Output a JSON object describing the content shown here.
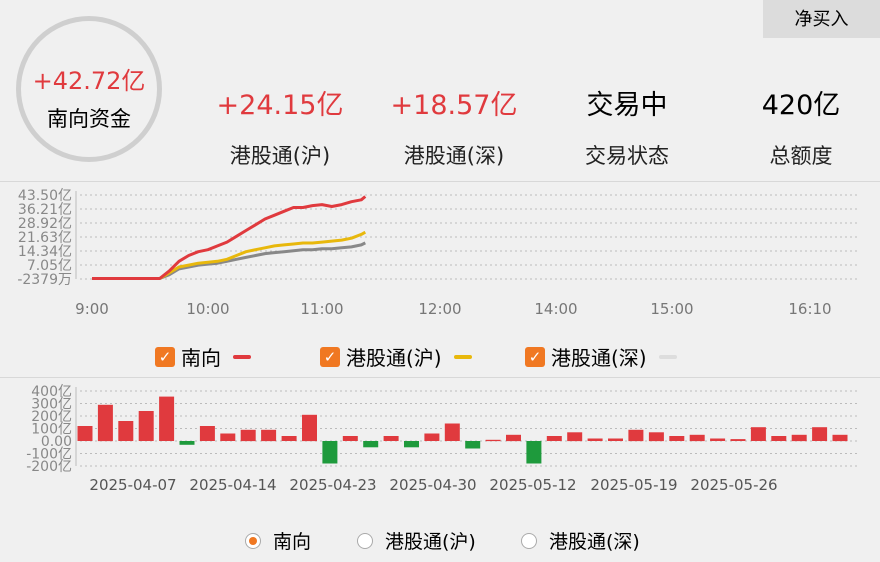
{
  "summary": {
    "total_value": "+42.72亿",
    "total_label": "南向资金",
    "buy_button": "净买入",
    "stats": [
      {
        "value": "+24.15亿",
        "label": "港股通(沪)"
      },
      {
        "value": "+18.57亿",
        "label": "港股通(深)"
      },
      {
        "value": "交易中",
        "label": "交易状态"
      },
      {
        "value": "420亿",
        "label": "总额度"
      }
    ]
  },
  "colors": {
    "up": "#e03a3e",
    "down": "#1e9a3c",
    "south": "#e03a3e",
    "sh": "#e8b80c",
    "sz": "#888888",
    "accent": "#f07822"
  },
  "chart_data": [
    {
      "type": "line",
      "x_ticks": [
        "9:00",
        "10:00",
        "11:00",
        "12:00",
        "14:00",
        "15:00",
        "16:10"
      ],
      "y_ticks": [
        "43.50亿",
        "36.21亿",
        "28.92亿",
        "21.63亿",
        "14.34亿",
        "7.05亿",
        "-2379万"
      ],
      "ylim": [
        -0.2379,
        43.5
      ],
      "grid": true,
      "series": [
        {
          "name": "南向",
          "color": "#e03a3e",
          "x": [
            "9:00",
            "9:15",
            "9:30",
            "9:35",
            "9:40",
            "9:45",
            "9:50",
            "9:55",
            "10:00",
            "10:05",
            "10:10",
            "10:15",
            "10:20",
            "10:25",
            "10:30",
            "10:35",
            "10:40",
            "10:45",
            "10:50",
            "10:55",
            "11:00",
            "11:05",
            "11:10",
            "11:15",
            "11:20",
            "11:22"
          ],
          "values": [
            0,
            0,
            0,
            0,
            4,
            9,
            12,
            14,
            15,
            17,
            19,
            22,
            25,
            28,
            31,
            33,
            35,
            37,
            37,
            38,
            38.5,
            37.5,
            38.5,
            40,
            41,
            42.72
          ]
        },
        {
          "name": "港股通(沪)",
          "color": "#e8b80c",
          "x": [
            "9:00",
            "9:15",
            "9:30",
            "9:35",
            "9:40",
            "9:45",
            "9:50",
            "9:55",
            "10:00",
            "10:05",
            "10:10",
            "10:15",
            "10:20",
            "10:25",
            "10:30",
            "10:35",
            "10:40",
            "10:45",
            "10:50",
            "10:55",
            "11:00",
            "11:05",
            "11:10",
            "11:15",
            "11:20",
            "11:22"
          ],
          "values": [
            0,
            0,
            0,
            0,
            3,
            6,
            7,
            8,
            8.5,
            9,
            10,
            12,
            14,
            15,
            16,
            17,
            17.5,
            18,
            18.5,
            18.5,
            19,
            19.5,
            20,
            21,
            23,
            24.15
          ]
        },
        {
          "name": "港股通(深)",
          "color": "#888888",
          "x": [
            "9:00",
            "9:15",
            "9:30",
            "9:35",
            "9:40",
            "9:45",
            "9:50",
            "9:55",
            "10:00",
            "10:05",
            "10:10",
            "10:15",
            "10:20",
            "10:25",
            "10:30",
            "10:35",
            "10:40",
            "10:45",
            "10:50",
            "10:55",
            "11:00",
            "11:05",
            "11:10",
            "11:15",
            "11:20",
            "11:22"
          ],
          "values": [
            0,
            0,
            0,
            0,
            2,
            5,
            6,
            7,
            7.5,
            8,
            9,
            10,
            11,
            12,
            13,
            13.5,
            14,
            14.5,
            15,
            15,
            15.5,
            15.5,
            16,
            16.5,
            17.5,
            18.57
          ]
        }
      ]
    },
    {
      "type": "bar",
      "y_ticks": [
        "400亿",
        "300亿",
        "200亿",
        "100亿",
        "0.00",
        "-100亿",
        "-200亿"
      ],
      "ylim": [
        -200,
        400
      ],
      "grid": true,
      "x_ticks": [
        "2025-04-07",
        "2025-04-14",
        "2025-04-23",
        "2025-04-30",
        "2025-05-12",
        "2025-05-19",
        "2025-05-26"
      ],
      "series_name": "南向",
      "values": [
        120,
        290,
        160,
        240,
        355,
        -30,
        120,
        60,
        90,
        90,
        40,
        210,
        -180,
        40,
        -50,
        40,
        -50,
        60,
        140,
        -60,
        10,
        50,
        -180,
        40,
        70,
        20,
        20,
        90,
        70,
        40,
        50,
        20,
        15,
        110,
        40,
        50,
        110,
        50
      ]
    }
  ],
  "legend": [
    {
      "label": "南向",
      "color": "#e03a3e"
    },
    {
      "label": "港股通(沪)",
      "color": "#e8b80c"
    },
    {
      "label": "港股通(深)",
      "color": "#dddddd"
    }
  ],
  "radios": [
    {
      "label": "南向",
      "selected": true
    },
    {
      "label": "港股通(沪)",
      "selected": false
    },
    {
      "label": "港股通(深)",
      "selected": false
    }
  ],
  "icons": {
    "check": "✓"
  }
}
